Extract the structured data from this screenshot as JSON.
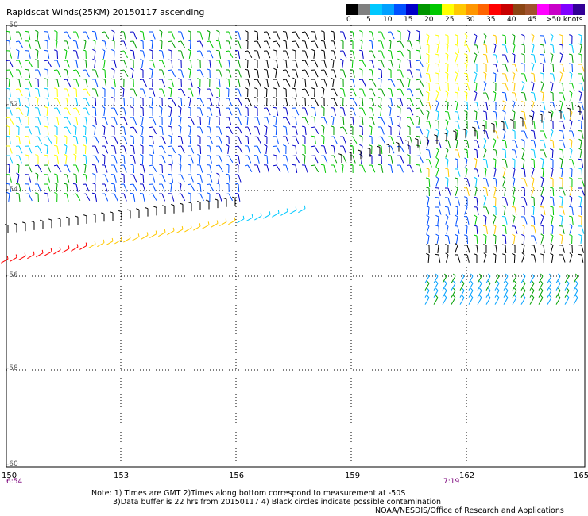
{
  "title": "Rapidscat Winds(25KM) 20150117 ascending",
  "colorbar": {
    "colors": [
      "#000000",
      "#7f7f7f",
      "#00c8ff",
      "#00a0ff",
      "#0050ff",
      "#0000c8",
      "#009600",
      "#00c800",
      "#ffff00",
      "#ffc800",
      "#ff9600",
      "#ff6400",
      "#ff0000",
      "#c80000",
      "#8b4513",
      "#a0522d",
      "#ff00ff",
      "#c800c8",
      "#8000ff",
      "#320096"
    ],
    "labels": [
      "0",
      "5",
      "10",
      "15",
      "20",
      "25",
      "30",
      "35",
      "40",
      "45",
      ">50 knots"
    ]
  },
  "map": {
    "lat_labels": [
      "-50",
      "-52",
      "-54",
      "-56",
      "-58",
      "-60"
    ],
    "lon_labels": [
      "150",
      "153",
      "156",
      "159",
      "162",
      "165"
    ],
    "time_labels": [
      "6:54",
      "7:19"
    ]
  },
  "notes": {
    "line1": "Note: 1) Times are GMT 2)Times along bottom correspond to measurement at -50S",
    "line2": "3)Data buffer is 22 hrs from 20150117 4) Black circles indicate possible contamination",
    "line3": "NOAA/NESDIS/Office of Research and Applications"
  }
}
